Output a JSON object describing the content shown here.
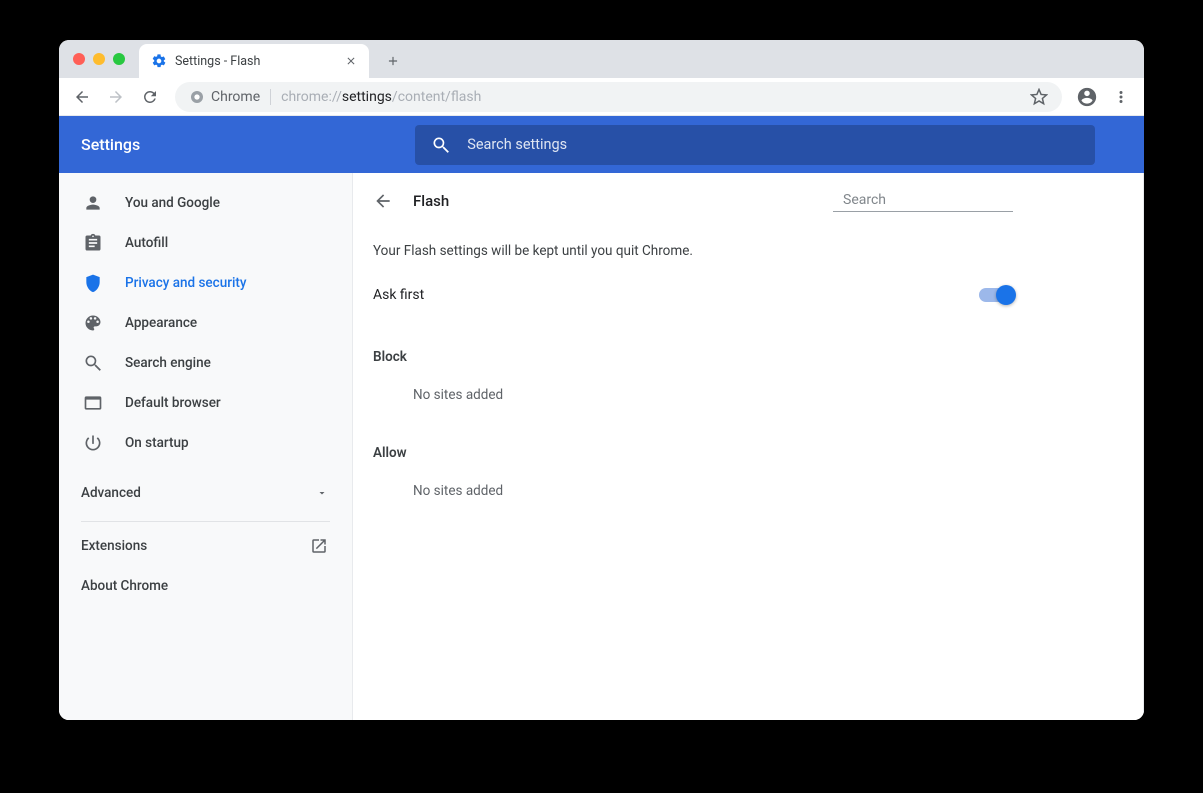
{
  "tab": {
    "title": "Settings - Flash"
  },
  "omnibox": {
    "chip": "Chrome",
    "prefix": "chrome://",
    "strong": "settings",
    "suffix": "/content/flash"
  },
  "header": {
    "title": "Settings",
    "search_placeholder": "Search settings"
  },
  "sidebar": {
    "items": [
      {
        "label": "You and Google"
      },
      {
        "label": "Autofill"
      },
      {
        "label": "Privacy and security"
      },
      {
        "label": "Appearance"
      },
      {
        "label": "Search engine"
      },
      {
        "label": "Default browser"
      },
      {
        "label": "On startup"
      }
    ],
    "advanced": "Advanced",
    "extensions": "Extensions",
    "about": "About Chrome"
  },
  "page": {
    "title": "Flash",
    "search_placeholder": "Search",
    "notice": "Your Flash settings will be kept until you quit Chrome.",
    "toggle_label": "Ask first",
    "toggle_on": true,
    "block_title": "Block",
    "block_empty": "No sites added",
    "allow_title": "Allow",
    "allow_empty": "No sites added"
  }
}
